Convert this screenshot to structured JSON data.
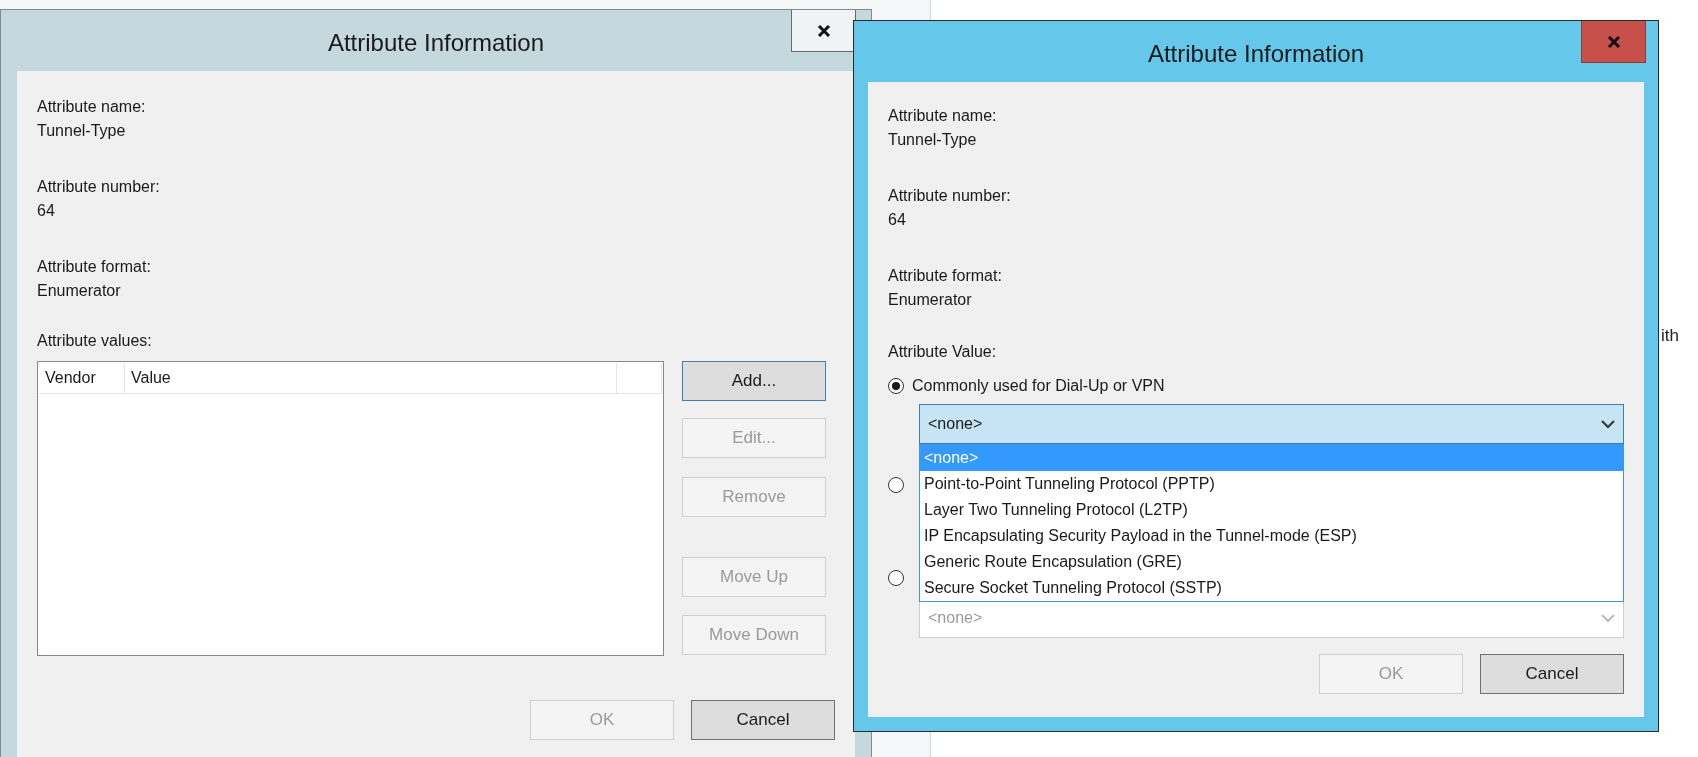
{
  "background_window": {
    "text": "ith"
  },
  "back_dialog": {
    "title": "Attribute Information",
    "active": false,
    "fields": [
      {
        "label": "Attribute name:",
        "value": "Tunnel-Type"
      },
      {
        "label": "Attribute number:",
        "value": "64"
      },
      {
        "label": "Attribute format:",
        "value": "Enumerator"
      }
    ],
    "values_label": "Attribute values:",
    "list_columns": [
      "Vendor",
      "Value"
    ],
    "side_buttons": [
      {
        "label": "Add...",
        "disabled": false,
        "focused": true
      },
      {
        "label": "Edit...",
        "disabled": true,
        "focused": false
      },
      {
        "label": "Remove",
        "disabled": true,
        "focused": false
      },
      {
        "label": "Move Up",
        "disabled": true,
        "focused": false
      },
      {
        "label": "Move Down",
        "disabled": true,
        "focused": false
      }
    ],
    "footer_buttons": [
      {
        "label": "OK",
        "disabled": true
      },
      {
        "label": "Cancel",
        "disabled": false
      }
    ]
  },
  "front_dialog": {
    "title": "Attribute Information",
    "active": true,
    "fields": [
      {
        "label": "Attribute name:",
        "value": "Tunnel-Type"
      },
      {
        "label": "Attribute number:",
        "value": "64"
      },
      {
        "label": "Attribute format:",
        "value": "Enumerator"
      }
    ],
    "value_label": "Attribute Value:",
    "options": [
      {
        "label": "Commonly used for Dial-Up or VPN",
        "selected": true
      },
      {
        "selected": false
      },
      {
        "selected": false
      }
    ],
    "dropdown": {
      "value": "<none>",
      "expanded": true,
      "items": [
        {
          "label": "<none>",
          "selected": true
        },
        {
          "label": "Point-to-Point Tunneling Protocol (PPTP)",
          "selected": false
        },
        {
          "label": "Layer Two Tunneling Protocol (L2TP)",
          "selected": false
        },
        {
          "label": "IP Encapsulating Security Payload in the Tunnel-mode (ESP)",
          "selected": false
        },
        {
          "label": "Generic Route Encapsulation (GRE)",
          "selected": false
        },
        {
          "label": "Secure Socket Tunneling Protocol (SSTP)",
          "selected": false
        }
      ]
    },
    "second_dropdown": {
      "value": "<none>",
      "disabled": true
    },
    "footer_buttons": [
      {
        "label": "OK",
        "disabled": true
      },
      {
        "label": "Cancel",
        "disabled": false
      }
    ]
  }
}
